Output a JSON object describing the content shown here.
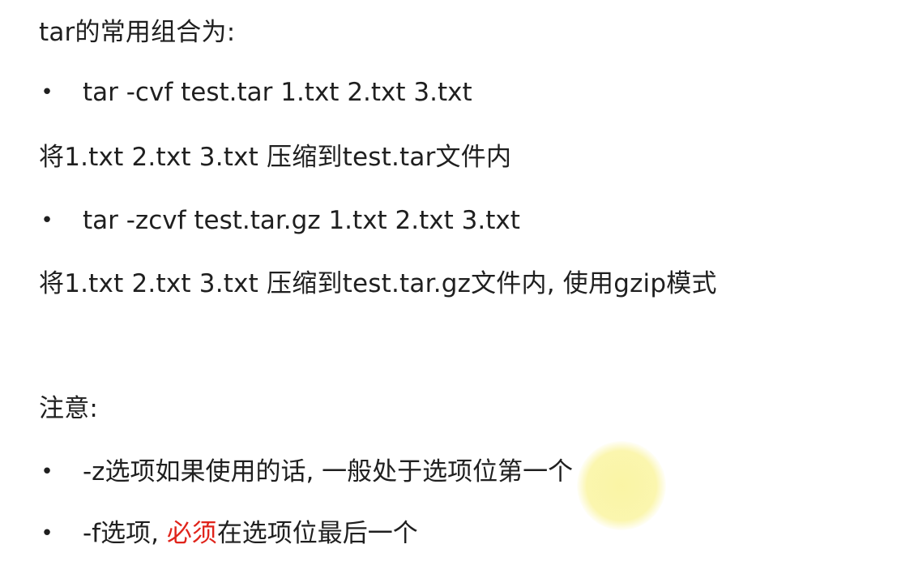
{
  "heading": "tar的常用组合为:",
  "items": [
    {
      "command": "tar -cvf test.tar 1.txt 2.txt 3.txt"
    },
    {
      "description": "将1.txt 2.txt 3.txt 压缩到test.tar文件内"
    },
    {
      "command": "tar -zcvf test.tar.gz 1.txt 2.txt 3.txt"
    },
    {
      "description": "将1.txt 2.txt 3.txt 压缩到test.tar.gz文件内, 使用gzip模式"
    }
  ],
  "note_heading": "注意:",
  "notes": [
    {
      "text": "-z选项如果使用的话, 一般处于选项位第一个"
    },
    {
      "prefix": "-f选项, ",
      "highlight": "必须",
      "suffix": "在选项位最后一个"
    }
  ],
  "colors": {
    "text": "#1f1f1f",
    "highlight_red": "#e0241b",
    "cursor_highlight": "#faf4a0"
  }
}
